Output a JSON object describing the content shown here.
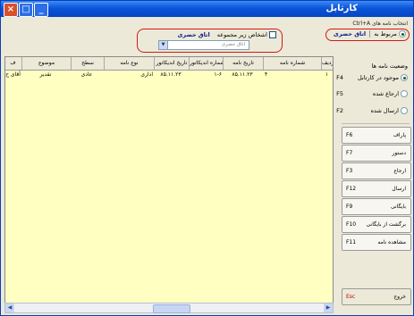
{
  "window": {
    "title": "کارتابل"
  },
  "top": {
    "select_label": "انتخاب نامه های",
    "shortcut": "Ctrl+A",
    "related_label": "مربوط به",
    "room_value": "اتاق حضری"
  },
  "filter": {
    "checkbox_label": "اشخاص زیر مجموعه",
    "room_value": "اتاق حضری",
    "combo_value": "اتاق حضری"
  },
  "grid": {
    "columns": [
      "ردیف",
      "شماره نامه",
      "تاریخ نامه",
      "شماره اندیکاتور",
      "تاریخ اندیکاتور",
      "نوع نامه",
      "سطح",
      "موضوع",
      "ف"
    ],
    "rows": [
      {
        "radif": "۱",
        "number": "۴",
        "date": "۸۵.۱۱.۲۳",
        "ind_number": "۱-۶",
        "ind_date": "۸۵.۱۱.۲۳",
        "type": "اداری",
        "level": "عادی",
        "subject": "تقدیر",
        "sender": "آقای ح"
      }
    ]
  },
  "sidebar": {
    "title": "وضعیت نامه ها",
    "statuses": [
      {
        "label": "موجود در کارتابل",
        "key": "F4",
        "selected": true
      },
      {
        "label": "ارجاع شده",
        "key": "F5",
        "selected": false
      },
      {
        "label": "ارسال شده",
        "key": "F2",
        "selected": false
      }
    ],
    "buttons": [
      {
        "label": "پاراف",
        "key": "F6"
      },
      {
        "label": "دستور",
        "key": "F7"
      },
      {
        "label": "ارجاع",
        "key": "F3"
      },
      {
        "label": "ارسال",
        "key": "F12"
      },
      {
        "label": "بایگانی",
        "key": "F9"
      },
      {
        "label": "برگشت از بایگانی",
        "key": "F10"
      },
      {
        "label": "مشاهده نامه",
        "key": "F11"
      }
    ],
    "exit": {
      "label": "خروج",
      "key": "Esc"
    }
  }
}
